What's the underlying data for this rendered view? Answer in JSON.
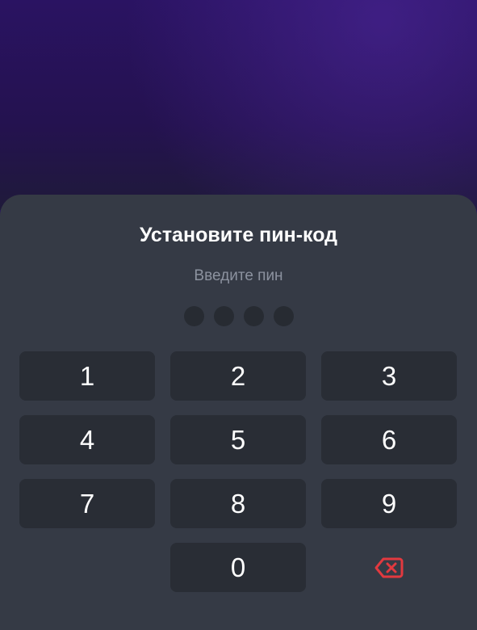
{
  "pin_sheet": {
    "title": "Установите пин-код",
    "subtitle": "Введите пин",
    "pin_length": 4,
    "entered_digits": 0
  },
  "keypad": {
    "keys": [
      "1",
      "2",
      "3",
      "4",
      "5",
      "6",
      "7",
      "8",
      "9",
      "0"
    ],
    "backspace_icon": "backspace-icon"
  },
  "colors": {
    "sheet_background": "#353a45",
    "key_background": "#292d35",
    "dot_empty": "#272b32",
    "backspace_accent": "#e2393f",
    "background_top": "#2a1362"
  }
}
